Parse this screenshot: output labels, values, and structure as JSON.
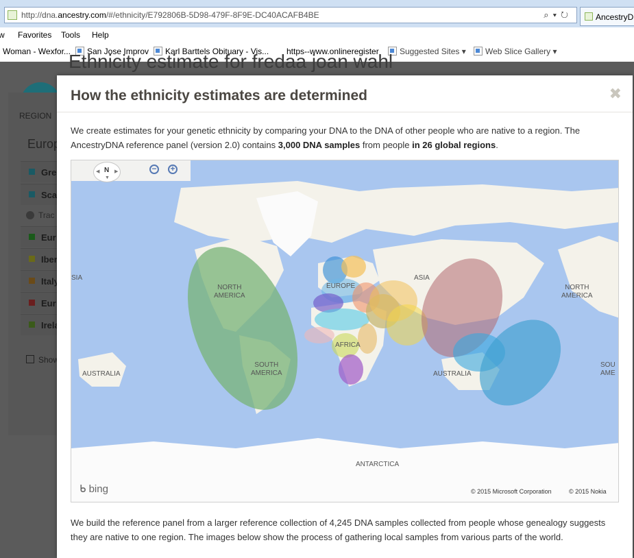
{
  "browser": {
    "url_prefix": "http://dna.",
    "url_domain": "ancestry.com",
    "url_rest": "/#/ethnicity/E792806B-5D98-479F-8F9E-DC40ACAFB4BE",
    "tab_title": "AncestryD",
    "menu": [
      "w",
      "Favorites",
      "Tools",
      "Help"
    ],
    "favorites": [
      "Woman - Wexfor...",
      "San Jose Improv",
      "Karl Barttels Obituary - Vis...",
      "https--www.onlineregister",
      "Suggested Sites",
      "Web Slice Gallery"
    ]
  },
  "background": {
    "page_title": "Ethnicity estimate for fredaa joan wahl",
    "region_header": "REGION",
    "group": "Europ",
    "rows": [
      "Gre",
      "Sca",
      "Eur",
      "Iber",
      "Italy",
      "Eur",
      "Irela"
    ],
    "row_colors": [
      "#1a5a64",
      "#1a5a64",
      "#1a5a1a",
      "#6a6a18",
      "#6a4a18",
      "#6a1e1e",
      "#3a5a1a"
    ],
    "trace": "Trac",
    "show_label": "Show"
  },
  "modal": {
    "title": "How the ethnicity estimates are determined",
    "close_glyph": "✖",
    "intro_1": "We create estimates for your genetic ethnicity by comparing your DNA to the DNA of other people who are native to a region. The AncestryDNA reference panel (version 2.0) contains ",
    "intro_bold_1": "3,000 DNA samples",
    "intro_2": " from people ",
    "intro_bold_2": "in 26 global regions",
    "intro_3": ".",
    "outro": "We build the reference panel from a larger reference collection of 4,245 DNA samples collected from people whose genealogy suggests they are native to one region. The images below show the process of gathering local samples from various parts of the world."
  },
  "map": {
    "compass_label": "N",
    "zoom_out": "−",
    "zoom_in": "+",
    "labels": {
      "north_america": "NORTH\nAMERICA",
      "south_america": "SOUTH\nAMERICA",
      "europe": "EUROPE",
      "africa": "AFRICA",
      "asia": "ASIA",
      "australia_left": "AUSTRALIA",
      "australia_right": "AUSTRALIA",
      "north_america_right": "NORTH\nAMERICA",
      "south_america_right": "SOU\nAME",
      "asia_left": "SIA",
      "antarctica": "ANTARCTICA"
    },
    "brand": "bing",
    "copyright_ms": "© 2015 Microsoft Corporation",
    "copyright_nokia": "© 2015 Nokia",
    "colors": {
      "ocean": "#a9c6ef",
      "land": "#f4f2ea",
      "ice": "#fbfbfb"
    }
  }
}
